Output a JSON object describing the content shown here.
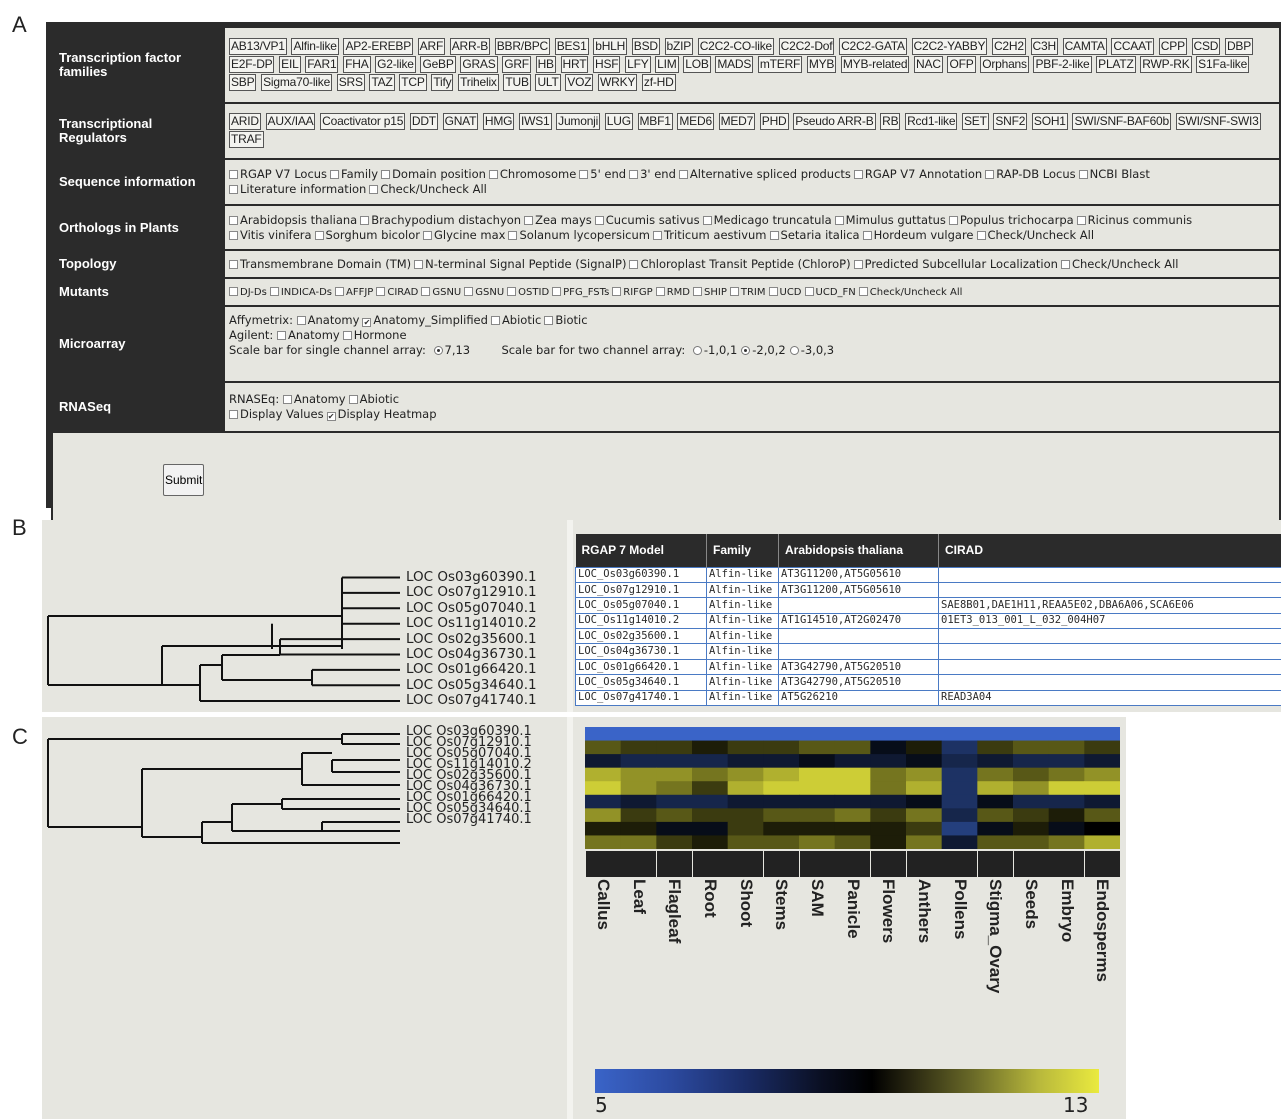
{
  "panel_letters": {
    "a": "A",
    "b": "B",
    "c": "C"
  },
  "form": {
    "tf_label": "Transcription factor families",
    "tf_families": [
      "AB13/VP1",
      "Alfin-like",
      "AP2-EREBP",
      "ARF",
      "ARR-B",
      "BBR/BPC",
      "BES1",
      "bHLH",
      "BSD",
      "bZIP",
      "C2C2-CO-like",
      "C2C2-Dof",
      "C2C2-GATA",
      "C2C2-YABBY",
      "C2H2",
      "C3H",
      "CAMTA",
      "CCAAT",
      "CPP",
      "CSD",
      "DBP",
      "E2F-DP",
      "EIL",
      "FAR1",
      "FHA",
      "G2-like",
      "GeBP",
      "GRAS",
      "GRF",
      "HB",
      "HRT",
      "HSF",
      "LFY",
      "LIM",
      "LOB",
      "MADS",
      "mTERF",
      "MYB",
      "MYB-related",
      "NAC",
      "OFP",
      "Orphans",
      "PBF-2-like",
      "PLATZ",
      "RWP-RK",
      "S1Fa-like",
      "SBP",
      "Sigma70-like",
      "SRS",
      "TAZ",
      "TCP",
      "Tify",
      "Trihelix",
      "TUB",
      "ULT",
      "VOZ",
      "WRKY",
      "zf-HD"
    ],
    "tr_label": "Transcriptional Regulators",
    "tr_items": [
      "ARID",
      "AUX/IAA",
      "Coactivator p15",
      "DDT",
      "GNAT",
      "HMG",
      "IWS1",
      "Jumonji",
      "LUG",
      "MBF1",
      "MED6",
      "MED7",
      "PHD",
      "Pseudo ARR-B",
      "RB",
      "Rcd1-like",
      "SET",
      "SNF2",
      "SOH1",
      "SWI/SNF-BAF60b",
      "SWI/SNF-SWI3",
      "TRAF"
    ],
    "seq_label": "Sequence information",
    "seq_items": [
      "RGAP V7 Locus",
      "Family",
      "Domain position",
      "Chromosome",
      "5' end",
      "3' end",
      "Alternative spliced products",
      "RGAP V7 Annotation",
      "RAP-DB Locus",
      "NCBI Blast",
      "Literature information",
      "Check/Uncheck All"
    ],
    "ortho_label": "Orthologs in Plants",
    "ortho_items": [
      "Arabidopsis thaliana",
      "Brachypodium distachyon",
      "Zea mays",
      "Cucumis sativus",
      "Medicago truncatula",
      "Mimulus guttatus",
      "Populus trichocarpa",
      "Ricinus communis",
      "Vitis vinifera",
      "Sorghum bicolor",
      "Glycine max",
      "Solanum lycopersicum",
      "Triticum aestivum",
      "Setaria italica",
      "Hordeum vulgare",
      "Check/Uncheck All"
    ],
    "topo_label": "Topology",
    "topo_items": [
      "Transmembrane Domain (TM)",
      "N-terminal Signal Peptide (SignalP)",
      "Chloroplast Transit Peptide (ChloroP)",
      "Predicted Subcellular Localization",
      "Check/Uncheck All"
    ],
    "mut_label": "Mutants",
    "mut_items": [
      "DJ-Ds",
      "INDICA-Ds",
      "AFFJP",
      "CIRAD",
      "GSNU",
      "GSNU",
      "OSTID",
      "PFG_FSTs",
      "RIFGP",
      "RMD",
      "SHIP",
      "TRIM",
      "UCD",
      "UCD_FN",
      "Check/Uncheck All"
    ],
    "micro_label": "Microarray",
    "affy_label": "Affymetrix:",
    "affy_items": [
      {
        "label": "Anatomy",
        "checked": false
      },
      {
        "label": "Anatomy_Simplified",
        "checked": true
      },
      {
        "label": "Abiotic",
        "checked": false
      },
      {
        "label": "Biotic",
        "checked": false
      }
    ],
    "agilent_label": "Agilent:",
    "agilent_items": [
      {
        "label": "Anatomy",
        "checked": false
      },
      {
        "label": "Hormone",
        "checked": false
      }
    ],
    "scale_single_label": "Scale bar for single channel array:",
    "scale_single_value": "7,13",
    "scale_two_label": "Scale bar for two channel array:",
    "scale_two_options": [
      {
        "label": "-1,0,1",
        "selected": false
      },
      {
        "label": "-2,0,2",
        "selected": true
      },
      {
        "label": "-3,0,3",
        "selected": false
      }
    ],
    "rnaseq_label": "RNASeq",
    "rnaseq_prefix": "RNASEq:",
    "rnaseq_items": [
      {
        "label": "Anatomy",
        "checked": false
      },
      {
        "label": "Abiotic",
        "checked": false
      }
    ],
    "display_items": [
      {
        "label": "Display Values",
        "checked": false
      },
      {
        "label": "Display Heatmap",
        "checked": true
      }
    ],
    "submit_label": "Submit"
  },
  "genes": [
    "LOC Os03g60390.1",
    "LOC Os07g12910.1",
    "LOC Os05g07040.1",
    "LOC Os11g14010.2",
    "LOC Os02g35600.1",
    "LOC Os04g36730.1",
    "LOC Os01g66420.1",
    "LOC Os05g34640.1",
    "LOC Os07g41740.1"
  ],
  "ortholog_table": {
    "headers": [
      "RGAP 7 Model",
      "Family",
      "Arabidopsis thaliana",
      "CIRAD"
    ],
    "rows": [
      [
        "LOC_Os03g60390.1",
        "Alfin-like",
        "AT3G11200,AT5G05610",
        ""
      ],
      [
        "LOC_Os07g12910.1",
        "Alfin-like",
        "AT3G11200,AT5G05610",
        ""
      ],
      [
        "LOC_Os05g07040.1",
        "Alfin-like",
        "",
        "SAE8B01,DAE1H11,REAA5E02,DBA6A06,SCA6E06"
      ],
      [
        "LOC_Os11g14010.2",
        "Alfin-like",
        "AT1G14510,AT2G02470",
        "01ET3_013_001_L_032_004H07"
      ],
      [
        "LOC_Os02g35600.1",
        "Alfin-like",
        "",
        ""
      ],
      [
        "LOC_Os04g36730.1",
        "Alfin-like",
        "",
        ""
      ],
      [
        "LOC_Os01g66420.1",
        "Alfin-like",
        "AT3G42790,AT5G20510",
        ""
      ],
      [
        "LOC_Os05g34640.1",
        "Alfin-like",
        "AT3G42790,AT5G20510",
        ""
      ],
      [
        "LOC_Os07g41740.1",
        "Alfin-like",
        "AT5G26210",
        "READ3A04"
      ]
    ]
  },
  "chart_data": {
    "type": "heatmap",
    "rows": [
      "LOC Os03g60390.1",
      "LOC Os07g12910.1",
      "LOC Os05g07040.1",
      "LOC Os11g14010.2",
      "LOC Os02g35600.1",
      "LOC Os04g36730.1",
      "LOC Os01g66420.1",
      "LOC Os05g34640.1",
      "LOC Os07g41740.1"
    ],
    "columns": [
      "Callus",
      "Leaf",
      "Flagleaf",
      "Root",
      "Shoot",
      "Stems",
      "SAM",
      "Panicle",
      "Flowers",
      "Anthers",
      "Pollens",
      "Stigma_Ovary",
      "Seeds",
      "Embryo",
      "Endosperms"
    ],
    "values": [
      [
        5,
        5,
        5,
        5,
        5,
        5,
        5,
        5,
        5,
        5,
        5,
        5,
        5,
        5,
        5
      ],
      [
        10.5,
        10,
        10,
        9.5,
        10,
        10,
        10.5,
        10.5,
        8.5,
        9.5,
        7,
        10,
        10.5,
        10.5,
        10
      ],
      [
        8,
        7.5,
        7.5,
        7.5,
        8,
        8,
        8.5,
        8,
        8,
        8.5,
        7.5,
        8,
        7.5,
        7.5,
        8
      ],
      [
        12,
        11.5,
        11.5,
        11,
        11.5,
        12,
        12.5,
        12.5,
        11,
        11.5,
        7,
        11,
        10.5,
        11,
        11.5
      ],
      [
        12.5,
        11.5,
        11,
        10,
        12,
        12.5,
        12.5,
        12.5,
        11,
        12,
        7,
        12,
        11.5,
        12.5,
        12.5
      ],
      [
        7.5,
        8,
        7.5,
        7.5,
        8,
        8,
        8,
        8,
        8,
        8.5,
        7,
        8.5,
        7.5,
        7.5,
        8
      ],
      [
        11.5,
        10,
        10.5,
        10,
        10,
        10.5,
        10.5,
        11,
        10,
        11,
        7.5,
        10.5,
        10,
        9.5,
        10.5
      ],
      [
        9.5,
        9.5,
        8.5,
        8.5,
        10,
        9.5,
        9.5,
        9.5,
        9.5,
        10,
        6.5,
        8.5,
        9.5,
        8.5,
        9
      ],
      [
        11,
        11,
        10,
        9.5,
        10.5,
        10.5,
        11,
        10.5,
        9.5,
        11,
        8,
        10.5,
        10.5,
        11,
        12
      ]
    ],
    "scale_min": "5",
    "scale_max": "13",
    "colors": {
      "low": "#3a64c8",
      "mid": "#000000",
      "high": "#eaea3e"
    }
  }
}
